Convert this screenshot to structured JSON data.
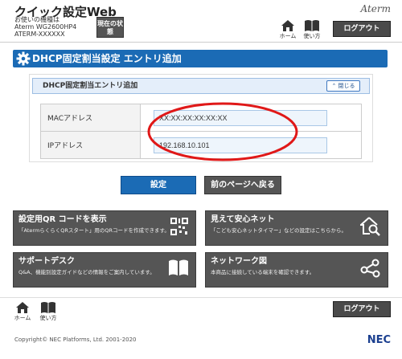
{
  "header": {
    "title": "クイック設定Web",
    "device_label": "お使いの機種は",
    "model": "Aterm WG2600HP4",
    "device_name": "ATERM-XXXXXX",
    "status_button": "現在の状態",
    "brand": "Aterm",
    "home_label": "ホーム",
    "help_label": "使い方",
    "logout_label": "ログアウト"
  },
  "page": {
    "title": "DHCP固定割当設定 エントリ追加",
    "section_title": "DHCP固定割当エントリ追加",
    "close_label": "閉じる",
    "fields": [
      {
        "label": "MACアドレス",
        "value": "XX:XX:XX:XX:XX:XX"
      },
      {
        "label": "IPアドレス",
        "value": "192.168.10.101"
      }
    ],
    "set_button": "設定",
    "back_button": "前のページへ戻る"
  },
  "tiles": [
    {
      "title": "設定用QR コードを表示",
      "desc": "「AtermらくらくQRスタート」用のQRコードを作成できます。",
      "icon": "qr-code-icon"
    },
    {
      "title": "見えて安心ネット",
      "desc": "「こども安心ネットタイマー」などの設定はこちらから。",
      "icon": "home-search-icon"
    },
    {
      "title": "サポートデスク",
      "desc": "Q&A、機能別設定ガイドなどの情報をご案内しています。",
      "icon": "book-icon"
    },
    {
      "title": "ネットワーク図",
      "desc": "本商品に接続している端末を確認できます。",
      "icon": "network-icon"
    }
  ],
  "footer": {
    "home_label": "ホーム",
    "help_label": "使い方",
    "logout_label": "ログアウト",
    "copyright": "Copyright© NEC Platforms, Ltd. 2001-2020",
    "logo": "NEC"
  },
  "colors": {
    "accent": "#1b6bb5",
    "dark_button": "#555555",
    "highlight": "#e01818"
  }
}
